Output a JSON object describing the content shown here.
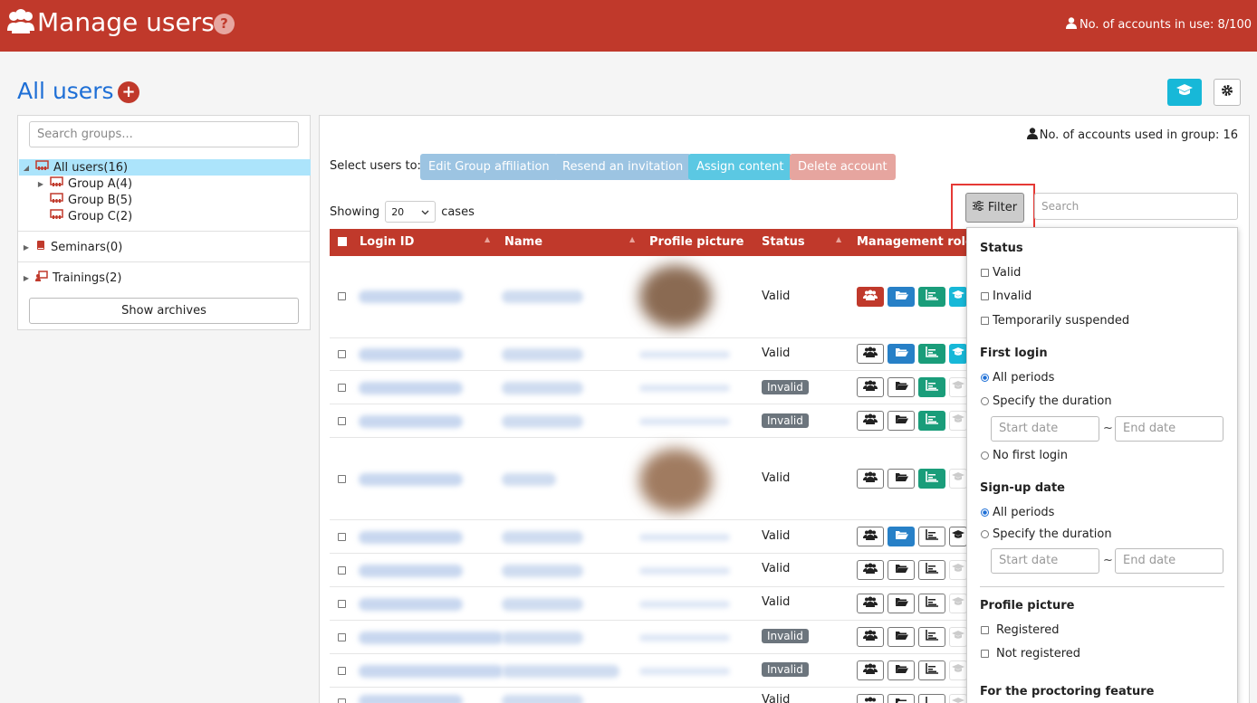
{
  "header": {
    "title": "Manage users",
    "help_label": "?",
    "accounts_in_use": "No. of accounts in use: 8/100",
    "icons": [
      "users-icon",
      "user-icon"
    ]
  },
  "page": {
    "title": "All users",
    "add_label": "+"
  },
  "sidebar": {
    "search_placeholder": "Search groups...",
    "tree": [
      {
        "label": "All users(16)",
        "selected": true
      },
      {
        "label": "Group A(4)"
      },
      {
        "label": "Group B(5)"
      },
      {
        "label": "Group C(2)"
      }
    ],
    "sections": [
      {
        "label": "Seminars(0)"
      },
      {
        "label": "Trainings(2)"
      }
    ],
    "show_archives": "Show archives"
  },
  "main": {
    "group_accounts": "No. of accounts used in group: 16",
    "select_label": "Select users to:",
    "actions": [
      {
        "label": "Edit Group affiliation",
        "color": "#9cc4e2"
      },
      {
        "label": "Resend an invitation",
        "color": "#9cc4e2"
      },
      {
        "label": "Assign content",
        "color": "#5bc8e3"
      },
      {
        "label": "Delete account",
        "color": "#e6a59f"
      }
    ],
    "showing_label": "Showing",
    "per_page": "20",
    "cases_label": "cases",
    "filter_label": "Filter",
    "search_placeholder": "Search"
  },
  "table": {
    "columns": [
      "Login ID",
      "Name",
      "Profile picture",
      "Status",
      "Management role"
    ],
    "rows": [
      {
        "status": "Valid"
      },
      {
        "status": "Valid"
      },
      {
        "status": "Invalid"
      },
      {
        "status": "Invalid"
      },
      {
        "status": "Valid"
      },
      {
        "status": "Valid"
      },
      {
        "status": "Valid"
      },
      {
        "status": "Valid"
      },
      {
        "status": "Invalid"
      },
      {
        "status": "Invalid"
      },
      {
        "status": "Valid"
      }
    ]
  },
  "filter_panel": {
    "status_heading": "Status",
    "status_options": [
      "Valid",
      "Invalid",
      "Temporarily suspended"
    ],
    "first_login_heading": "First login",
    "first_login_all": "All periods",
    "first_login_specify": "Specify the duration",
    "first_login_none": "No first login",
    "signup_heading": "Sign-up date",
    "signup_all": "All periods",
    "signup_specify": "Specify the duration",
    "start_date": "Start date",
    "end_date": "End date",
    "tilde": "~",
    "picture_heading": "Profile picture",
    "picture_registered": "Registered",
    "picture_not_registered": "Not registered",
    "proctoring_heading": "For the proctoring feature"
  },
  "colors": {
    "brand_red": "#c0392b",
    "link_blue": "#1e6fd6",
    "cyan": "#17b8d8",
    "green": "#1a9d7a",
    "blue": "#2780c7",
    "invalid_badge": "#6c757d"
  }
}
